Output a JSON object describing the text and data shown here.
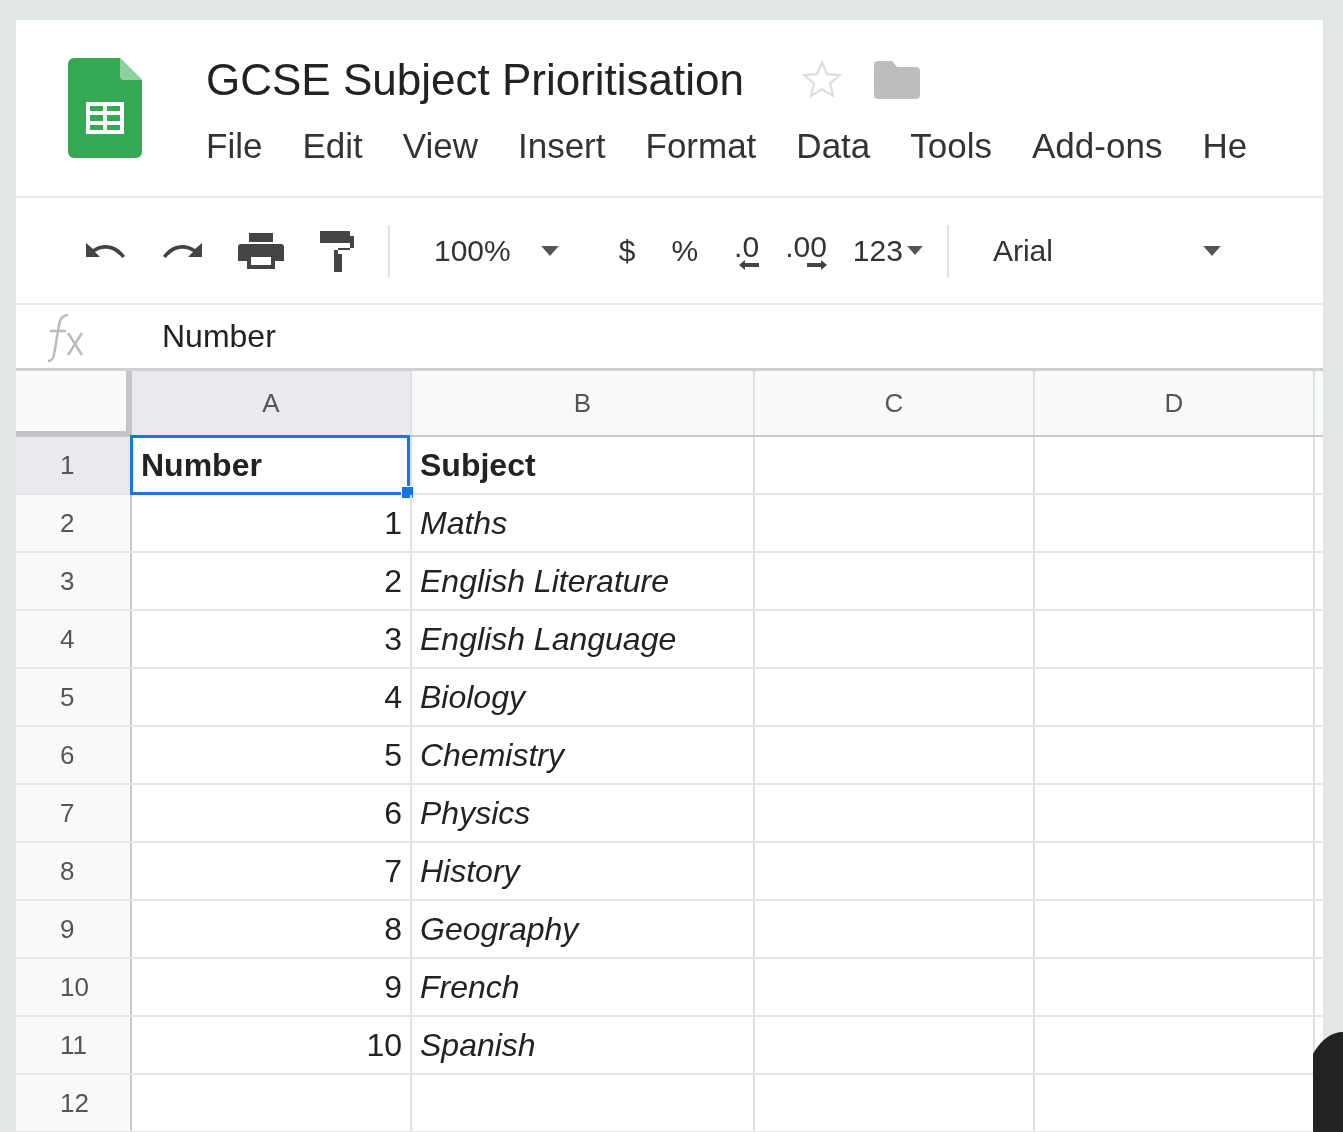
{
  "document": {
    "title": "GCSE Subject Prioritisation",
    "starred": false
  },
  "menu": [
    {
      "label": "File"
    },
    {
      "label": "Edit"
    },
    {
      "label": "View"
    },
    {
      "label": "Insert"
    },
    {
      "label": "Format"
    },
    {
      "label": "Data"
    },
    {
      "label": "Tools"
    },
    {
      "label": "Add-ons"
    },
    {
      "label": "He"
    }
  ],
  "toolbar": {
    "zoom": "100%",
    "currency": "$",
    "percent": "%",
    "decrease_decimals": ".0",
    "increase_decimals": ".00",
    "more_formats": "123",
    "font": "Arial"
  },
  "formula_bar": {
    "value": "Number"
  },
  "sheet": {
    "columns": [
      {
        "label": "A",
        "selected": true
      },
      {
        "label": "B",
        "selected": false
      },
      {
        "label": "C",
        "selected": false
      },
      {
        "label": "D",
        "selected": false
      }
    ],
    "rows": [
      {
        "number": "1",
        "selected": true,
        "cells": [
          {
            "text": "Number",
            "kind": "header",
            "selected": true
          },
          {
            "text": "Subject",
            "kind": "header",
            "selected": false
          }
        ]
      },
      {
        "number": "2",
        "selected": false,
        "cells": [
          {
            "text": "1",
            "kind": "number",
            "selected": false
          },
          {
            "text": "Maths",
            "kind": "subject",
            "selected": false
          }
        ]
      },
      {
        "number": "3",
        "selected": false,
        "cells": [
          {
            "text": "2",
            "kind": "number",
            "selected": false
          },
          {
            "text": "English Literature",
            "kind": "subject",
            "selected": false
          }
        ]
      },
      {
        "number": "4",
        "selected": false,
        "cells": [
          {
            "text": "3",
            "kind": "number",
            "selected": false
          },
          {
            "text": "English Language",
            "kind": "subject",
            "selected": false
          }
        ]
      },
      {
        "number": "5",
        "selected": false,
        "cells": [
          {
            "text": "4",
            "kind": "number",
            "selected": false
          },
          {
            "text": "Biology",
            "kind": "subject",
            "selected": false
          }
        ]
      },
      {
        "number": "6",
        "selected": false,
        "cells": [
          {
            "text": "5",
            "kind": "number",
            "selected": false
          },
          {
            "text": "Chemistry",
            "kind": "subject",
            "selected": false
          }
        ]
      },
      {
        "number": "7",
        "selected": false,
        "cells": [
          {
            "text": "6",
            "kind": "number",
            "selected": false
          },
          {
            "text": "Physics",
            "kind": "subject",
            "selected": false
          }
        ]
      },
      {
        "number": "8",
        "selected": false,
        "cells": [
          {
            "text": "7",
            "kind": "number",
            "selected": false
          },
          {
            "text": "History",
            "kind": "subject",
            "selected": false
          }
        ]
      },
      {
        "number": "9",
        "selected": false,
        "cells": [
          {
            "text": "8",
            "kind": "number",
            "selected": false
          },
          {
            "text": "Geography",
            "kind": "subject",
            "selected": false
          }
        ]
      },
      {
        "number": "10",
        "selected": false,
        "cells": [
          {
            "text": "9",
            "kind": "number",
            "selected": false
          },
          {
            "text": "French",
            "kind": "subject",
            "selected": false
          }
        ]
      },
      {
        "number": "11",
        "selected": false,
        "cells": [
          {
            "text": "10",
            "kind": "number",
            "selected": false
          },
          {
            "text": "Spanish",
            "kind": "subject",
            "selected": false
          }
        ]
      },
      {
        "number": "12",
        "selected": false,
        "cells": []
      }
    ]
  }
}
